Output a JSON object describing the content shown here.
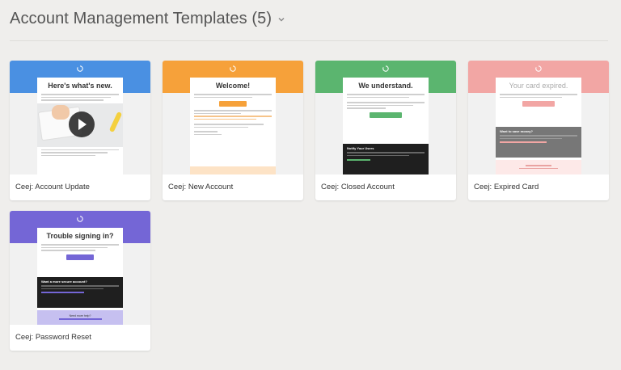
{
  "header": {
    "title": "Account Management Templates (5)"
  },
  "cards": [
    {
      "label": "Ceej: Account Update",
      "accent": "#4a90e2",
      "heading": "Here's what's new."
    },
    {
      "label": "Ceej: New Account",
      "accent": "#f6a13a",
      "heading": "Welcome!"
    },
    {
      "label": "Ceej: Closed Account",
      "accent": "#5bb56f",
      "heading": "We understand.",
      "dark_title": "Notify Your Users"
    },
    {
      "label": "Ceej: Expired Card",
      "accent": "#f2a6a4",
      "heading": "Your card expired.",
      "dark_title": "Want to save money?"
    },
    {
      "label": "Ceej: Password Reset",
      "accent": "#7466d6",
      "heading": "Trouble signing in?",
      "dark_title": "Want a more secure account?",
      "foot_title": "Need more help?"
    }
  ]
}
